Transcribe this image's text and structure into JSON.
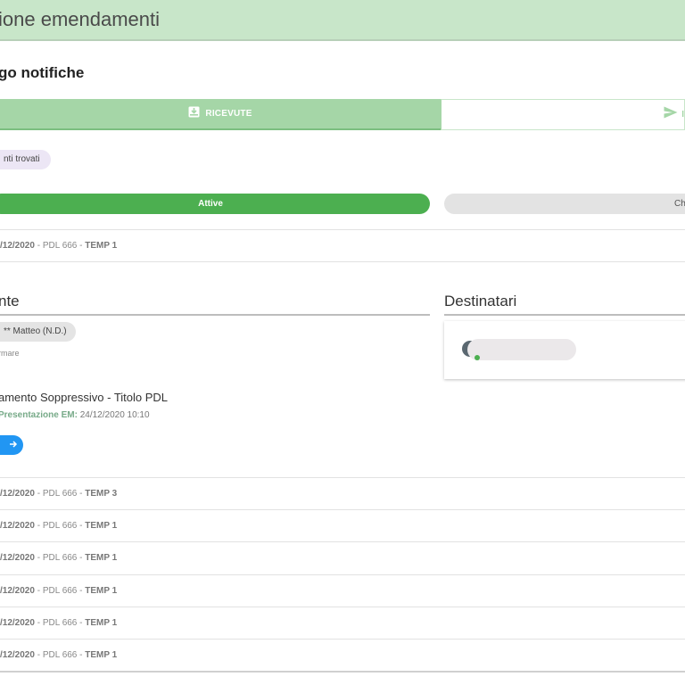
{
  "header": {
    "title": "ione emendamenti"
  },
  "page": {
    "title": "go notifiche"
  },
  "tabs": {
    "received": {
      "label": "RICEVUTE",
      "icon": "inbox-download-icon"
    },
    "sent": {
      "label": "I",
      "icon": "send-icon"
    }
  },
  "filter": {
    "found_label": "nti trovati"
  },
  "status_tabs": {
    "active": "Attive",
    "closed": "Ch"
  },
  "rows": [
    {
      "date": "/12/2020",
      "sep": " - ",
      "pdl": "PDL 666",
      "temp": "TEMP 1"
    },
    {
      "date": "/12/2020",
      "sep": " - ",
      "pdl": "PDL 666",
      "temp": "TEMP 3"
    },
    {
      "date": "/12/2020",
      "sep": " - ",
      "pdl": "PDL 666",
      "temp": "TEMP 1"
    },
    {
      "date": "/12/2020",
      "sep": " - ",
      "pdl": "PDL 666",
      "temp": "TEMP 1"
    },
    {
      "date": "/12/2020",
      "sep": " - ",
      "pdl": "PDL 666",
      "temp": "TEMP 1"
    },
    {
      "date": "/12/2020",
      "sep": " - ",
      "pdl": "PDL 666",
      "temp": "TEMP 1"
    },
    {
      "date": "/12/2020",
      "sep": " - ",
      "pdl": "PDL 666",
      "temp": "TEMP 1"
    }
  ],
  "detail": {
    "sender_heading": "nte",
    "recipients_heading": "Destinatari",
    "sender_name": "** Matteo (N.D.)",
    "sender_sub": "rmare",
    "amendment_title": "amento Soppressivo - Titolo PDL",
    "presentation_label": "Presentazione EM:",
    "presentation_value": "24/12/2020 10:10",
    "open_icon": "arrow-right-icon"
  },
  "colors": {
    "header_bg": "#c8e6c9",
    "active_green": "#4caf50",
    "tab_green": "#a5d6a7",
    "button_blue": "#2196f3"
  }
}
